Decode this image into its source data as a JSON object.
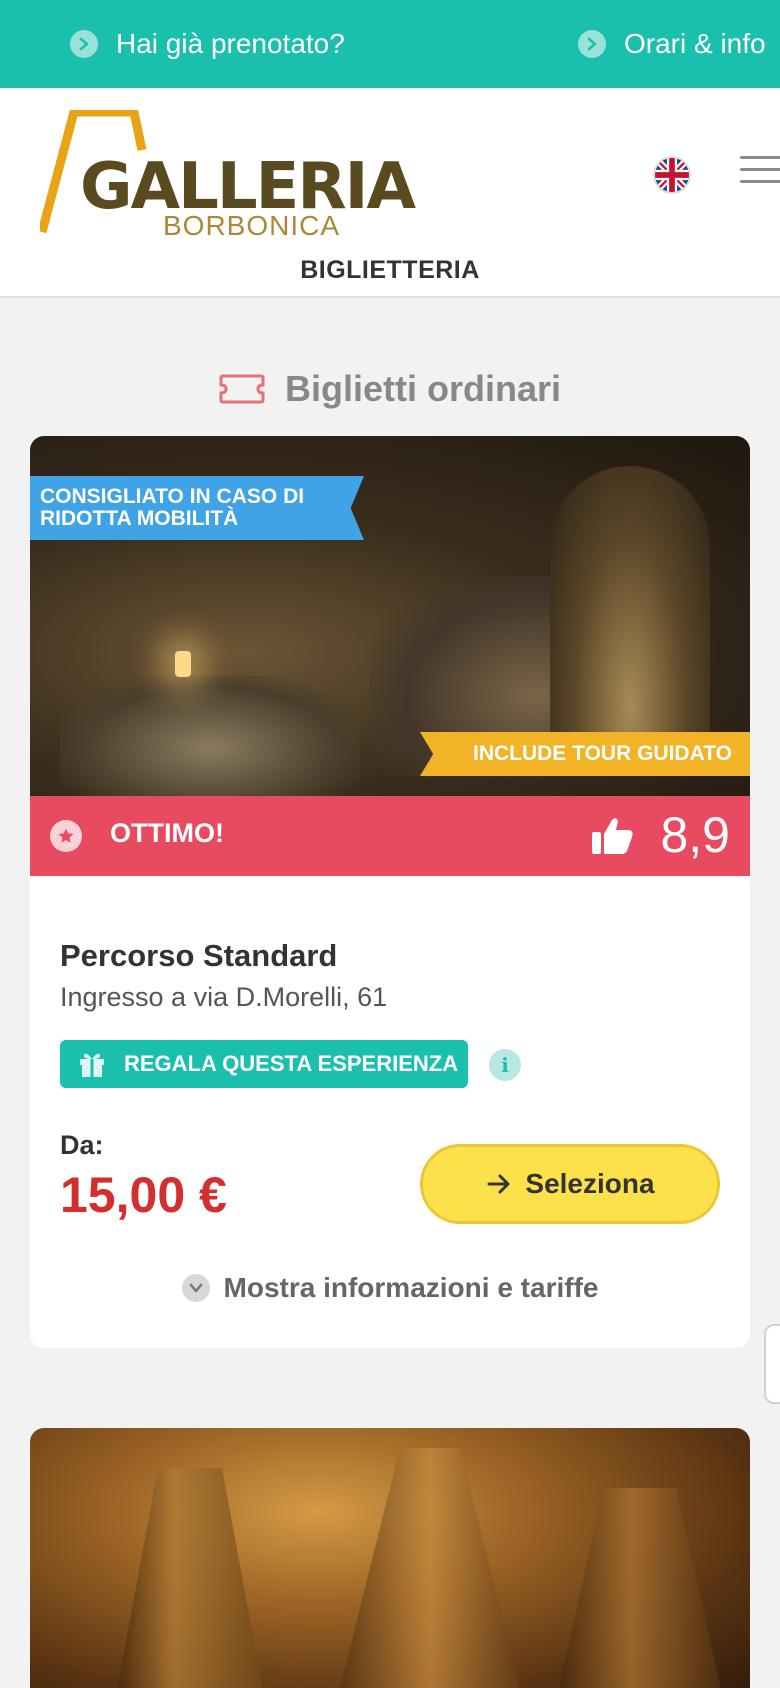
{
  "topbar": {
    "booked_link": "Hai già prenotato?",
    "hours_link": "Orari & info"
  },
  "header": {
    "logo_word": "GALLERIA",
    "logo_sub": "BORBONICA",
    "section_label": "BIGLIETTERIA",
    "language_flag": "uk-flag-icon",
    "menu_icon": "hamburger-menu-icon"
  },
  "section": {
    "title": "Biglietti ordinari",
    "icon": "ticket-icon"
  },
  "card": {
    "ribbon_top": "CONSIGLIATO IN CASO DI RIDOTTA MOBILITÀ",
    "ribbon_bottom": "INCLUDE TOUR GUIDATO",
    "rating_label": "OTTIMO!",
    "rating_score": "8,9",
    "title": "Percorso Standard",
    "subtitle": "Ingresso a via D.Morelli, 61",
    "gift_label": "REGALA QUESTA ESPERIENZA",
    "info_glyph": "i",
    "price_label": "Da:",
    "price": "15,00 €",
    "select_label": "Seleziona",
    "more_info": "Mostra informazioni e tariffe"
  },
  "colors": {
    "teal": "#1bbfae",
    "rating_red": "#e84a5f",
    "price_red": "#d32f2f",
    "ribbon_blue": "#3fa3e6",
    "ribbon_yellow": "#f2b426",
    "button_yellow": "#fde14b"
  }
}
